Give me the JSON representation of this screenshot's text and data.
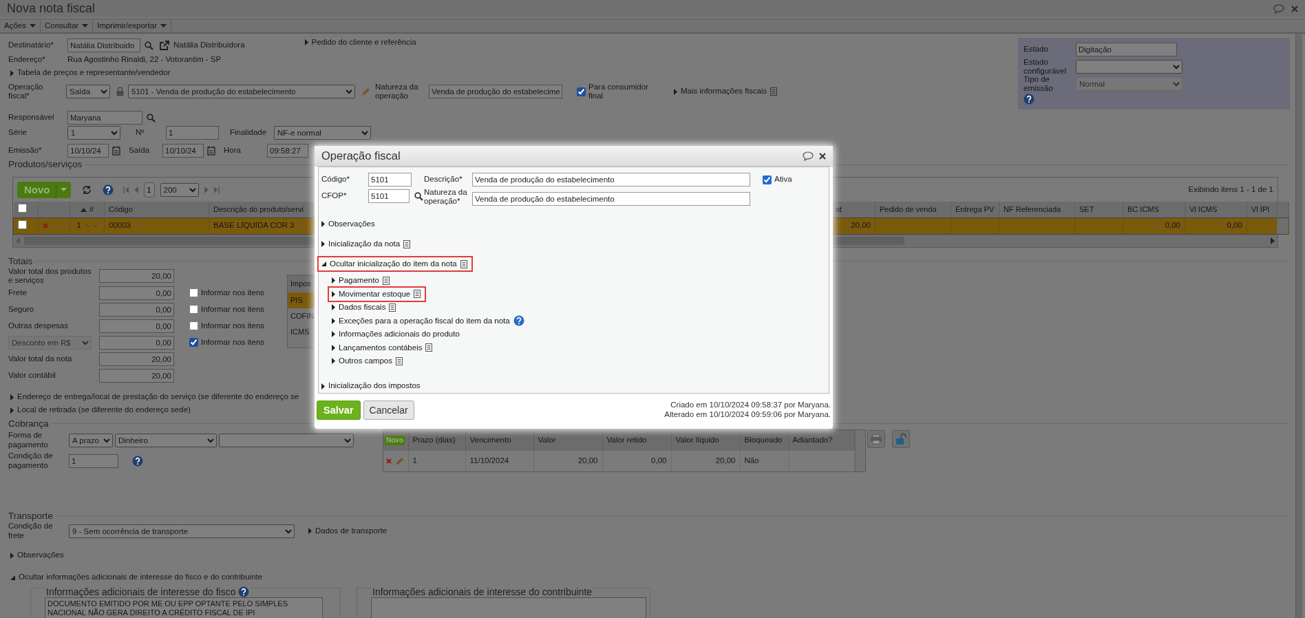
{
  "window": {
    "title": "Nova nota fiscal"
  },
  "menu": [
    {
      "label": "Ações"
    },
    {
      "label": "Consultar"
    },
    {
      "label": "Imprimir/exportar"
    }
  ],
  "header": {
    "destinatario": {
      "label": "Destinatário*",
      "value": "Natália Distribuido",
      "link": "Natália Distribuidora"
    },
    "pedido": {
      "label": "Pedido do cliente e referência",
      "expanded": false
    },
    "endereco": {
      "label": "Endereço*",
      "value": "Rua Agostinho Rinaldi, 22 - Votorantim - SP"
    },
    "tabela": {
      "label": "Tabela de preços e representante/vendedor",
      "expanded": false
    },
    "operacao": {
      "label": "Operação fiscal*",
      "tipo": "Saída",
      "value": "5101 - Venda de produção do estabelecimento"
    },
    "natureza": {
      "label": "Natureza da operação",
      "value": "Venda de produção do estabelecime"
    },
    "consumidor": {
      "label": "Para consumidor final",
      "checked": true
    },
    "mais": {
      "label": "Mais informações fiscais",
      "expanded": false
    },
    "responsavel": {
      "label": "Responsável",
      "value": "Maryana"
    },
    "serie": {
      "label": "Série",
      "value": "1"
    },
    "numero": {
      "label": "Nº",
      "value": "1"
    },
    "finalidade": {
      "label": "Finalidade",
      "value": "NF-e normal"
    },
    "emissao": {
      "label": "Emissão*",
      "value": "10/10/24"
    },
    "saida": {
      "label": "Saída",
      "value": "10/10/24"
    },
    "hora": {
      "label": "Hora",
      "value": "09:58:27"
    }
  },
  "status_panel": {
    "estado": {
      "label": "Estado",
      "value": "Digitação"
    },
    "estado_configuravel": {
      "label": "Estado configurável"
    },
    "tipo_emissao": {
      "label": "Tipo de emissão",
      "value": "Normal",
      "disabled": true
    }
  },
  "products": {
    "title": "Produtos/serviços",
    "new_button": "Novo",
    "page": "1",
    "page_size": "200",
    "info": "Exibindo itens 1 - 1 de 1",
    "select_all_checked": false,
    "columns": [
      "#",
      "Código",
      "Descrição do produto/servi",
      "ot",
      "Pedido de venda",
      "Entrega PV",
      "NF Referenciada",
      "SET",
      "BC ICMS",
      "Vl ICMS",
      "Vl IPI"
    ],
    "rows": [
      {
        "selected": true,
        "checked": false,
        "cells": [
          "1",
          "00003",
          "BASE LÍQUIDA COR 3",
          "20,00",
          null,
          null,
          null,
          null,
          "0,00",
          "0,00",
          null
        ]
      }
    ]
  },
  "totals": {
    "title": "Totais",
    "rows": [
      {
        "kind": "text",
        "label": "Valor total dos produtos e serviços",
        "value": "20,00"
      },
      {
        "kind": "text",
        "label": "Frete",
        "value": "0,00",
        "informar": {
          "label": "Informar nos itens",
          "checked": false
        }
      },
      {
        "kind": "text",
        "label": "Seguro",
        "value": "0,00",
        "informar": {
          "label": "Informar nos itens",
          "checked": false
        }
      },
      {
        "kind": "text",
        "label": "Outras despesas",
        "value": "0,00",
        "informar": {
          "label": "Informar nos itens",
          "checked": false
        }
      },
      {
        "kind": "select",
        "label": "Desconto em R$",
        "value": "0,00",
        "informar": {
          "label": "Informar nos itens",
          "checked": true
        }
      },
      {
        "kind": "text",
        "label": "Valor total da nota",
        "value": "20,00"
      },
      {
        "kind": "text",
        "label": "Valor contábil",
        "value": "20,00"
      }
    ]
  },
  "taxes": {
    "header": "Impos",
    "rows": [
      {
        "label": "PIS",
        "selected": true
      },
      {
        "label": "COFIN",
        "selected": false
      },
      {
        "label": "ICMS",
        "selected": false
      }
    ]
  },
  "address_links": [
    {
      "label": "Endereço de entrega/local de prestação do serviço (se diferente do endereço se",
      "expanded": false
    },
    {
      "label": "Local de retirada (se diferente do endereço sede)",
      "expanded": false
    }
  ],
  "cobranca": {
    "title": "Cobrança",
    "forma": {
      "label": "Forma de pagamento",
      "tipo": "A prazo",
      "meio": "Dinheiro"
    },
    "condicao": {
      "label": "Condição de pagamento",
      "value": "1"
    },
    "table": {
      "new_button": "Novo",
      "columns": [
        "Prazo (dias)",
        "Vencimento",
        "Valor",
        "Valor retido",
        "Valor líquido",
        "Bloqueado",
        "Adiantado?"
      ],
      "rows": [
        {
          "cells": [
            "1",
            "11/10/2024",
            "20,00",
            "0,00",
            "20,00",
            "Não",
            null
          ]
        }
      ]
    }
  },
  "transporte": {
    "title": "Transporte",
    "condicao": {
      "label": "Condição de frete",
      "value": "9 - Sem ocorrência de transporte"
    },
    "dados": {
      "label": "Dados de transporte",
      "expanded": false
    }
  },
  "observacoes": {
    "label": "Observações",
    "expanded": false
  },
  "info": {
    "toggle": {
      "label": "Ocultar informações adicionais de interesse do fisco e do contribuinte",
      "expanded": true
    },
    "fisco": {
      "title": "Informações adicionais de interesse do fisco",
      "text": "DOCUMENTO EMITIDO POR ME OU EPP OPTANTE PELO SIMPLES NACIONAL NÃO GERA DIREITO A CRÉDITO FISCAL DE IPI"
    },
    "contribuinte": {
      "title": "Informações adicionais de interesse do contribuinte"
    }
  },
  "dialog": {
    "title": "Operação fiscal",
    "codigo": {
      "label": "Código*",
      "value": "5101"
    },
    "cfop": {
      "label": "CFOP*",
      "value": "5101"
    },
    "descricao": {
      "label": "Descrição*",
      "value": "Venda de produção do estabelecimento"
    },
    "natureza": {
      "label": "Natureza da operação*",
      "value": "Venda de produção do estabelecimento"
    },
    "ativa": {
      "label": "Ativa",
      "checked": true
    },
    "sections": [
      {
        "label": "Observações",
        "kind": "plain",
        "expanded": false,
        "highlighted": false
      },
      {
        "label": "Inicialização da nota",
        "kind": "doc",
        "expanded": false,
        "highlighted": false
      },
      {
        "label": "Ocultar inicialização do item da nota",
        "kind": "doc",
        "expanded": true,
        "highlighted": true,
        "children": [
          {
            "label": "Pagamento",
            "kind": "doc",
            "expanded": false,
            "highlighted": false
          },
          {
            "label": "Movimentar estoque",
            "kind": "doc",
            "expanded": false,
            "highlighted": true
          },
          {
            "label": "Dados fiscais",
            "kind": "doc",
            "expanded": false,
            "highlighted": false
          },
          {
            "label": "Exceções para a operação fiscal do item da nota",
            "kind": "help",
            "expanded": false,
            "highlighted": false
          },
          {
            "label": "Informações adicionais do produto",
            "kind": "plain",
            "expanded": false,
            "highlighted": false
          },
          {
            "label": "Lançamentos contábeis",
            "kind": "doc",
            "expanded": false,
            "highlighted": false
          },
          {
            "label": "Outros campos",
            "kind": "doc",
            "expanded": false,
            "highlighted": false
          }
        ]
      },
      {
        "label": "Inicialização dos impostos",
        "kind": "plain",
        "expanded": false,
        "highlighted": false
      }
    ],
    "buttons": [
      {
        "label": "Salvar",
        "kind": "primary"
      },
      {
        "label": "Cancelar",
        "kind": "secondary"
      }
    ],
    "audit": [
      "Criado em 10/10/2024 09:58:37 por Maryana.",
      "Alterado em 10/10/2024 09:59:06 por Maryana."
    ]
  }
}
